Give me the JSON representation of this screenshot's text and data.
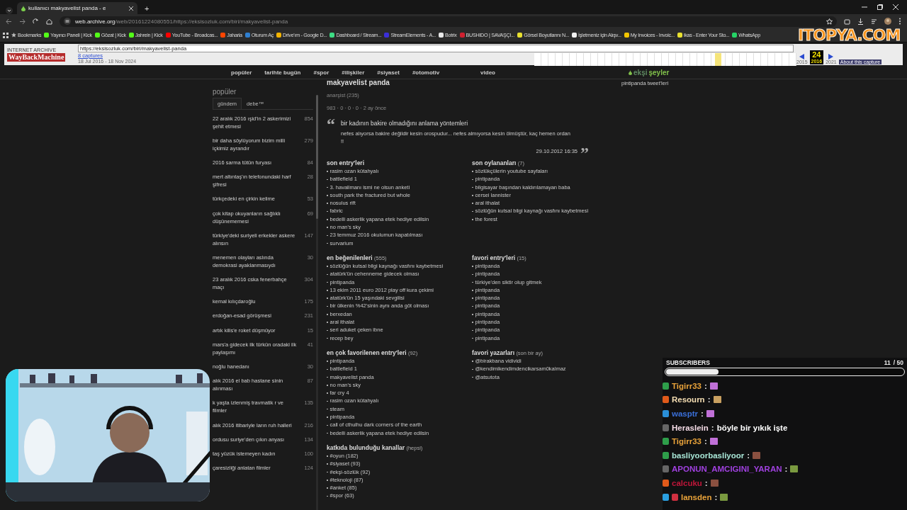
{
  "browser": {
    "tab_title": "kullanıcı makyavelist panda - e",
    "new_tab": "+",
    "url_host": "web.archive.org",
    "url_path": "/web/20161224080551/https://eksisozluk.com/biri/makyavelist-panda",
    "bookmarks": [
      {
        "label": "Bookmarks",
        "kind": "folder",
        "color": "#bbbbbb"
      },
      {
        "label": "Yayıncı Paneli | Kick",
        "kind": "site",
        "color": "#53fc18"
      },
      {
        "label": "Gözat | Kick",
        "kind": "site",
        "color": "#53fc18"
      },
      {
        "label": "Jahrein | Kick",
        "kind": "site",
        "color": "#53fc18"
      },
      {
        "label": "YouTube - Broadcas...",
        "kind": "site",
        "color": "#ff0000"
      },
      {
        "label": "Jaharia",
        "kind": "site",
        "color": "#ff4500"
      },
      {
        "label": "Oturum Aç",
        "kind": "site",
        "color": "#2f7fd0"
      },
      {
        "label": "Drive'ım - Google D...",
        "kind": "site",
        "color": "#f4b400"
      },
      {
        "label": "Dashboard / Stream...",
        "kind": "site",
        "color": "#3ddc84"
      },
      {
        "label": "StreamElements - A...",
        "kind": "site",
        "color": "#3b2fd8"
      },
      {
        "label": "Botrix",
        "kind": "site",
        "color": "#e8e8e8"
      },
      {
        "label": "BUSHIDO | SAVAŞÇI...",
        "kind": "site",
        "color": "#d02030"
      },
      {
        "label": "Görsel Boyutlarını N...",
        "kind": "site",
        "color": "#e8e030"
      },
      {
        "label": "İşletmeniz için Alışv...",
        "kind": "site",
        "color": "#f0f0f0"
      },
      {
        "label": "My Invoices - Invoic...",
        "kind": "site",
        "color": "#f2c500"
      },
      {
        "label": "ikas - Enter Your Sto...",
        "kind": "site",
        "color": "#e8e030"
      },
      {
        "label": "WhatsApp",
        "kind": "site",
        "color": "#25d366"
      }
    ]
  },
  "wayback": {
    "archive_label": "INTERNET ARCHIVE",
    "logo": "WayBackMachine",
    "url": "https://eksisozluk.com/biri/makyavelist-panda",
    "captures": "8 captures",
    "range": "18 Jul 2016 - 18 Nov 2024",
    "day": "24",
    "years": [
      "2015",
      "2016",
      "2021"
    ],
    "about": "About this capture"
  },
  "sponsor": {
    "text": "ITOPYA.COM"
  },
  "nav": {
    "items": [
      "popüler",
      "tarihte bugün",
      "#spor",
      "#ilişkiler",
      "#siyaset",
      "#otomotiv",
      "video"
    ],
    "logo_faint": "ekşi",
    "logo": "şeyler"
  },
  "sidebar": {
    "title": "popüler",
    "tabs": [
      {
        "label": "gündem",
        "selected": true
      },
      {
        "label": "debe™",
        "selected": false
      }
    ],
    "topics": [
      {
        "title": "22 aralık 2016 ışid'in 2 askerimizi şehit etmesi",
        "count": "854"
      },
      {
        "title": "bir daha söylüyorum bizim milli içkimiz ayrandır",
        "count": "279"
      },
      {
        "title": "2016 sarma tütün furyası",
        "count": "84"
      },
      {
        "title": "mert altıntaş'ın telefonundaki harf şifresi",
        "count": "28"
      },
      {
        "title": "türkçedeki en çirkin kelime",
        "count": "53"
      },
      {
        "title": "çok kitap okuyanların sağlıklı düşünememesi",
        "count": "69"
      },
      {
        "title": "türkiye'deki suriyeli erkekler askere alınsın",
        "count": "147"
      },
      {
        "title": "menemen olayları aslında demokrasi ayaklanmasıydı",
        "count": "30"
      },
      {
        "title": "23 aralık 2016 cska fenerbahçe maçı",
        "count": "304"
      },
      {
        "title": "kemal kılıçdaroğlu",
        "count": "175"
      },
      {
        "title": "erdoğan-esad görüşmesi",
        "count": "231"
      },
      {
        "title": "artık kilis'e roket düşmüyor",
        "count": "15"
      },
      {
        "title": "mars'a gidecek ilk türkün oradaki ilk paylaşımı",
        "count": "41"
      },
      {
        "title": "noğlu hanedanı",
        "count": "30"
      },
      {
        "title": "alık 2016 el bab hastane sinin alınması",
        "count": "87"
      },
      {
        "title": "k yaşta izlenmiş travmatik r ve filmler",
        "count": "135"
      },
      {
        "title": "alık 2016 itibariyle ların ruh halleri",
        "count": "216"
      },
      {
        "title": "ordusu suriye'den çıkın anyası",
        "count": "134"
      },
      {
        "title": "taş yüzük istemeyen kadın",
        "count": "100"
      },
      {
        "title": "çaresizliği anlatan filmler",
        "count": "124"
      }
    ]
  },
  "profile": {
    "nick": "makyavelist panda",
    "rank": "anarşist (235)",
    "stats": "983 · 0 · 0 · 0 · 2 ay önce",
    "tweets_link": "pintipanda tweet'leri",
    "quote": {
      "open_mark": "“",
      "title": "bir kadının bakire olmadığını anlama yöntemleri",
      "body": "nefes alıyorsa bakire değildir kesin orospudur... nefes almıyorsa kesin ölmüştür, kaç hemen ordan !!",
      "date": "29.10.2012 16:35",
      "close_mark": "”"
    },
    "sections": [
      {
        "title": "son entry'leri",
        "items": [
          "rasim ozan kütahyalı",
          "battlefield 1",
          "3. havalimanı ismi ne olsun anketi",
          "south park the fractured but whole",
          "nosulus rift",
          "fabric",
          "bedelli askerlik yapana etek hediye edilsin",
          "no man's sky",
          "23 temmuz 2016 okulumun kapatılması",
          "survarium"
        ]
      },
      {
        "title": "son oylananları",
        "count": "(7)",
        "items": [
          "sözlükçülerin youtube sayfaları",
          "pintipanda",
          "bilgisayar başından kaldırılamayan baba",
          "cersei lannister",
          "aral ithalat",
          "sözlüğün kutsal bilgi kaynağı vasfını kaybetmesi",
          "the forest"
        ]
      },
      {
        "title": "en beğenilenleri",
        "count": "(555)",
        "items": [
          "sözlüğün kutsal bilgi kaynağı vasfını kaybetmesi",
          "atatürk'ün cehenneme gidecek olması",
          "pintipanda",
          "13 ekim 2011 euro 2012 play off kura çekimi",
          "atatürk'ün 15 yaşındaki sevgilisi",
          "bir ülkenin %42'sinin aynı anda göt olması",
          "berxedan",
          "aral ithalat",
          "seri aduket çeken ibne",
          "recep bey"
        ]
      },
      {
        "title": "favori entry'leri",
        "count": "(15)",
        "items": [
          "pintipanda",
          "pintipanda",
          "türkiye'den siktir olup gitmek",
          "pintipanda",
          "pintipanda",
          "pintipanda",
          "pintipanda",
          "pintipanda",
          "pintipanda",
          "pintipanda"
        ]
      },
      {
        "title": "en çok favorilenen entry'leri",
        "count": "(92)",
        "items": [
          "pintipanda",
          "battlefield 1",
          "makyavelist panda",
          "no man's sky",
          "far cry 4",
          "rasim ozan kütahyalı",
          "steam",
          "pintipanda",
          "call of cthulhu dark corners of the earth",
          "bedelli askerlik yapana etek hediye edilsin"
        ]
      },
      {
        "title": "favori yazarları",
        "count": "(son bir ay)",
        "items": [
          "@birakbana vidividi",
          "@kendimikendimdencikarsam0kalmaz",
          "@atsutota"
        ]
      },
      {
        "title": "katkıda bulunduğu kanallar",
        "count": "(hepsi)",
        "items": [
          "#oyun (182)",
          "#siyaset (93)",
          "#ekşi-sözlük (92)",
          "#teknoloji (87)",
          "#anket (85)",
          "#spor (63)"
        ]
      }
    ]
  },
  "chat": {
    "goal_label": "SUBSCRIBERS",
    "goal_count": "11",
    "goal_total": "/ 50",
    "level": 0.22,
    "messages": [
      {
        "user": "Tigirr33",
        "color": "#e8a23a",
        "badges": [
          {
            "color": "#2e9e4a"
          }
        ],
        "separator": ":",
        "kind": "emote",
        "emote": {
          "color": "#c070d8"
        }
      },
      {
        "user": "Resourn",
        "color": "#f5deb3",
        "badges": [
          {
            "color": "#e05a1a"
          }
        ],
        "separator": ":",
        "kind": "emote",
        "emote": {
          "color": "#c8a060"
        }
      },
      {
        "user": "wasptr",
        "color": "#3a6fd8",
        "badges": [
          {
            "color": "#2a8fd8"
          }
        ],
        "separator": ":",
        "kind": "emote",
        "emote": {
          "color": "#c070d8"
        }
      },
      {
        "user": "Heraslein",
        "color": "#f4dbe6",
        "badges": [
          {
            "color": "#666666"
          }
        ],
        "separator": ":",
        "kind": "text",
        "text": "böyle bir yıkık işte"
      },
      {
        "user": "Tigirr33",
        "color": "#e8a23a",
        "badges": [
          {
            "color": "#2e9e4a"
          }
        ],
        "separator": ":",
        "kind": "emote",
        "emote": {
          "color": "#c070d8"
        }
      },
      {
        "user": "basliyoorbasliyoor",
        "color": "#a8e6d6",
        "badges": [
          {
            "color": "#2e9e4a"
          }
        ],
        "separator": ":",
        "kind": "emote",
        "emote": {
          "color": "#8a5040"
        }
      },
      {
        "user": "APONUN_AMCIGINI_YARAN",
        "color": "#a040e0",
        "badges": [
          {
            "color": "#666666"
          }
        ],
        "separator": ":",
        "kind": "emote",
        "emote": {
          "color": "#7a9a40"
        }
      },
      {
        "user": "calcuku",
        "color": "#c0163a",
        "badges": [
          {
            "color": "#e05a1a"
          }
        ],
        "separator": ":",
        "kind": "emote",
        "emote": {
          "color": "#8a5040"
        }
      },
      {
        "user": "lansden",
        "color": "#e8a23a",
        "badges": [
          {
            "color": "#2a9fe0"
          },
          {
            "color": "#d03040"
          }
        ],
        "separator": ":",
        "kind": "emote",
        "emote": {
          "color": "#7a9a40"
        }
      }
    ]
  }
}
